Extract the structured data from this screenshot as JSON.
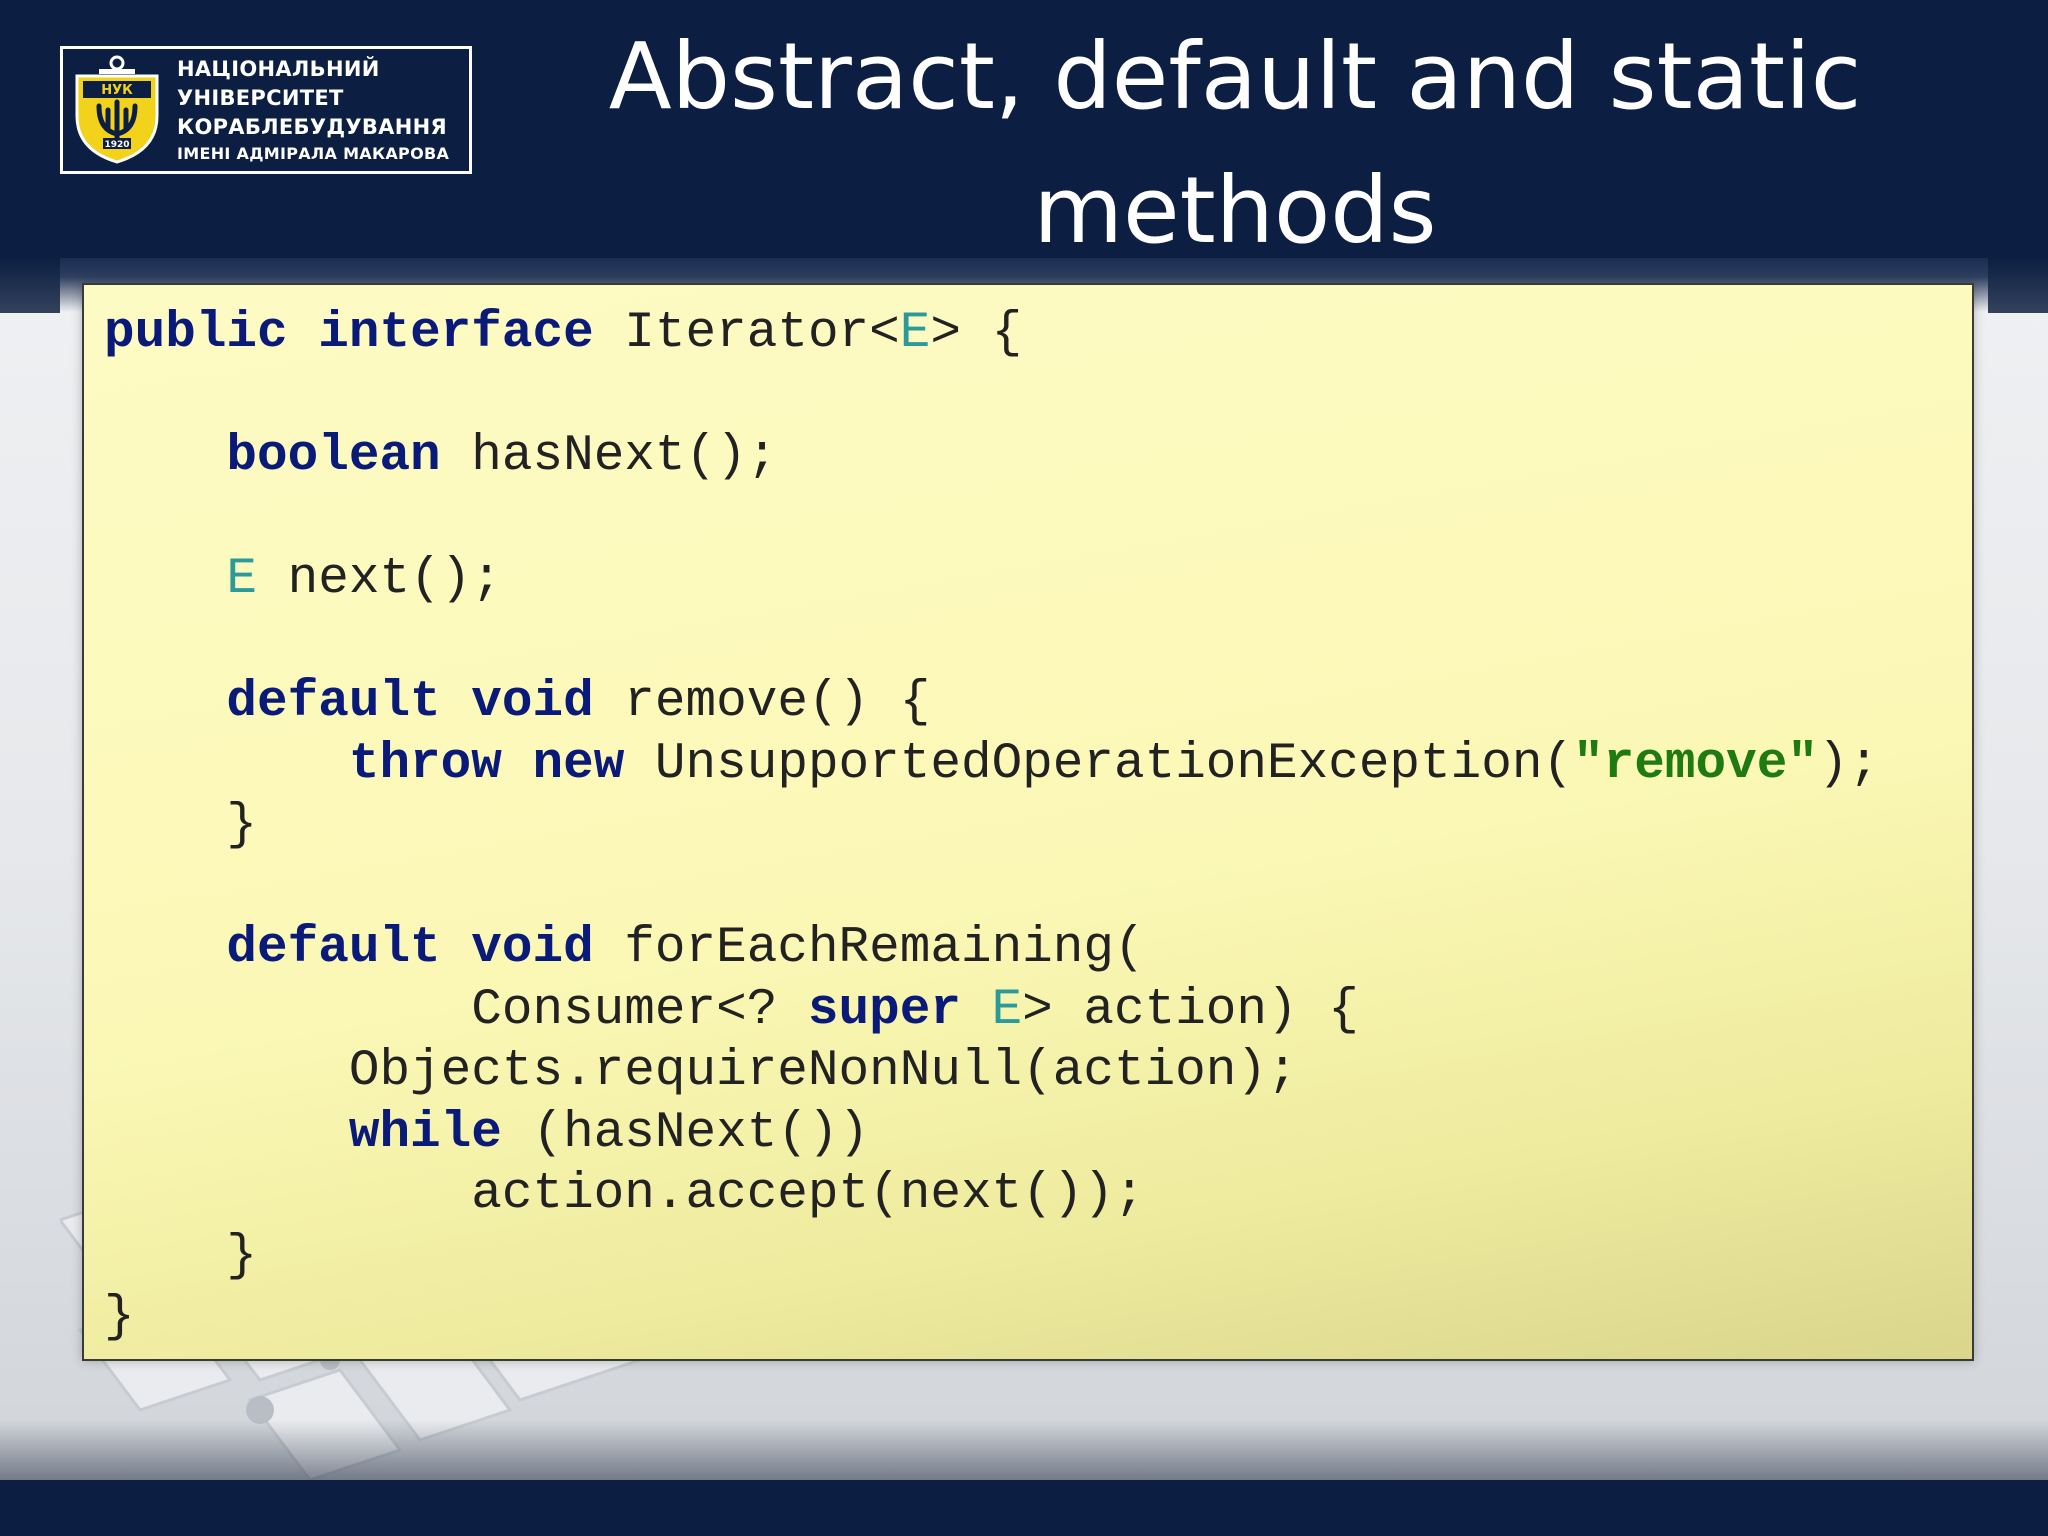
{
  "logo": {
    "emblem_text": "НУК",
    "emblem_year": "1920",
    "lines": [
      "НАЦІОНАЛЬНИЙ",
      "УНІВЕРСИТЕТ",
      "КОРАБЛЕБУДУВАННЯ",
      "ІМЕНІ АДМІРАЛА МАКАРОВА"
    ]
  },
  "title": {
    "line1": "Abstract, default and static",
    "line2": "methods"
  },
  "code": {
    "lines": [
      [
        {
          "t": "public",
          "c": "kw"
        },
        {
          "t": " "
        },
        {
          "t": "interface",
          "c": "kw"
        },
        {
          "t": " Iterator<"
        },
        {
          "t": "E",
          "c": "tp"
        },
        {
          "t": "> {"
        }
      ],
      [],
      [
        {
          "t": "    "
        },
        {
          "t": "boolean",
          "c": "kw"
        },
        {
          "t": " hasNext();"
        }
      ],
      [],
      [
        {
          "t": "    "
        },
        {
          "t": "E",
          "c": "tp"
        },
        {
          "t": " next();"
        }
      ],
      [],
      [
        {
          "t": "    "
        },
        {
          "t": "default",
          "c": "kw"
        },
        {
          "t": " "
        },
        {
          "t": "void",
          "c": "kw"
        },
        {
          "t": " remove() {"
        }
      ],
      [
        {
          "t": "        "
        },
        {
          "t": "throw",
          "c": "kw"
        },
        {
          "t": " "
        },
        {
          "t": "new",
          "c": "kw"
        },
        {
          "t": " UnsupportedOperationException("
        },
        {
          "t": "\"remove\"",
          "c": "str"
        },
        {
          "t": ");"
        }
      ],
      [
        {
          "t": "    }"
        }
      ],
      [],
      [
        {
          "t": "    "
        },
        {
          "t": "default",
          "c": "kw"
        },
        {
          "t": " "
        },
        {
          "t": "void",
          "c": "kw"
        },
        {
          "t": " forEachRemaining("
        }
      ],
      [
        {
          "t": "            Consumer<? "
        },
        {
          "t": "super",
          "c": "kw"
        },
        {
          "t": " "
        },
        {
          "t": "E",
          "c": "tp"
        },
        {
          "t": "> action) {"
        }
      ],
      [
        {
          "t": "        Objects.requireNonNull(action);"
        }
      ],
      [
        {
          "t": "        "
        },
        {
          "t": "while",
          "c": "kw"
        },
        {
          "t": " (hasNext())"
        }
      ],
      [
        {
          "t": "            action.accept(next());"
        }
      ],
      [
        {
          "t": "    }"
        }
      ],
      [
        {
          "t": "}"
        }
      ]
    ]
  },
  "colors": {
    "header_navy": "#0c1f42",
    "keyword": "#0a1a78",
    "type_param": "#2a9a9a",
    "string": "#1f7a12",
    "code_bg": "#fbf8b6",
    "logo_shield": "#f2d21b"
  }
}
